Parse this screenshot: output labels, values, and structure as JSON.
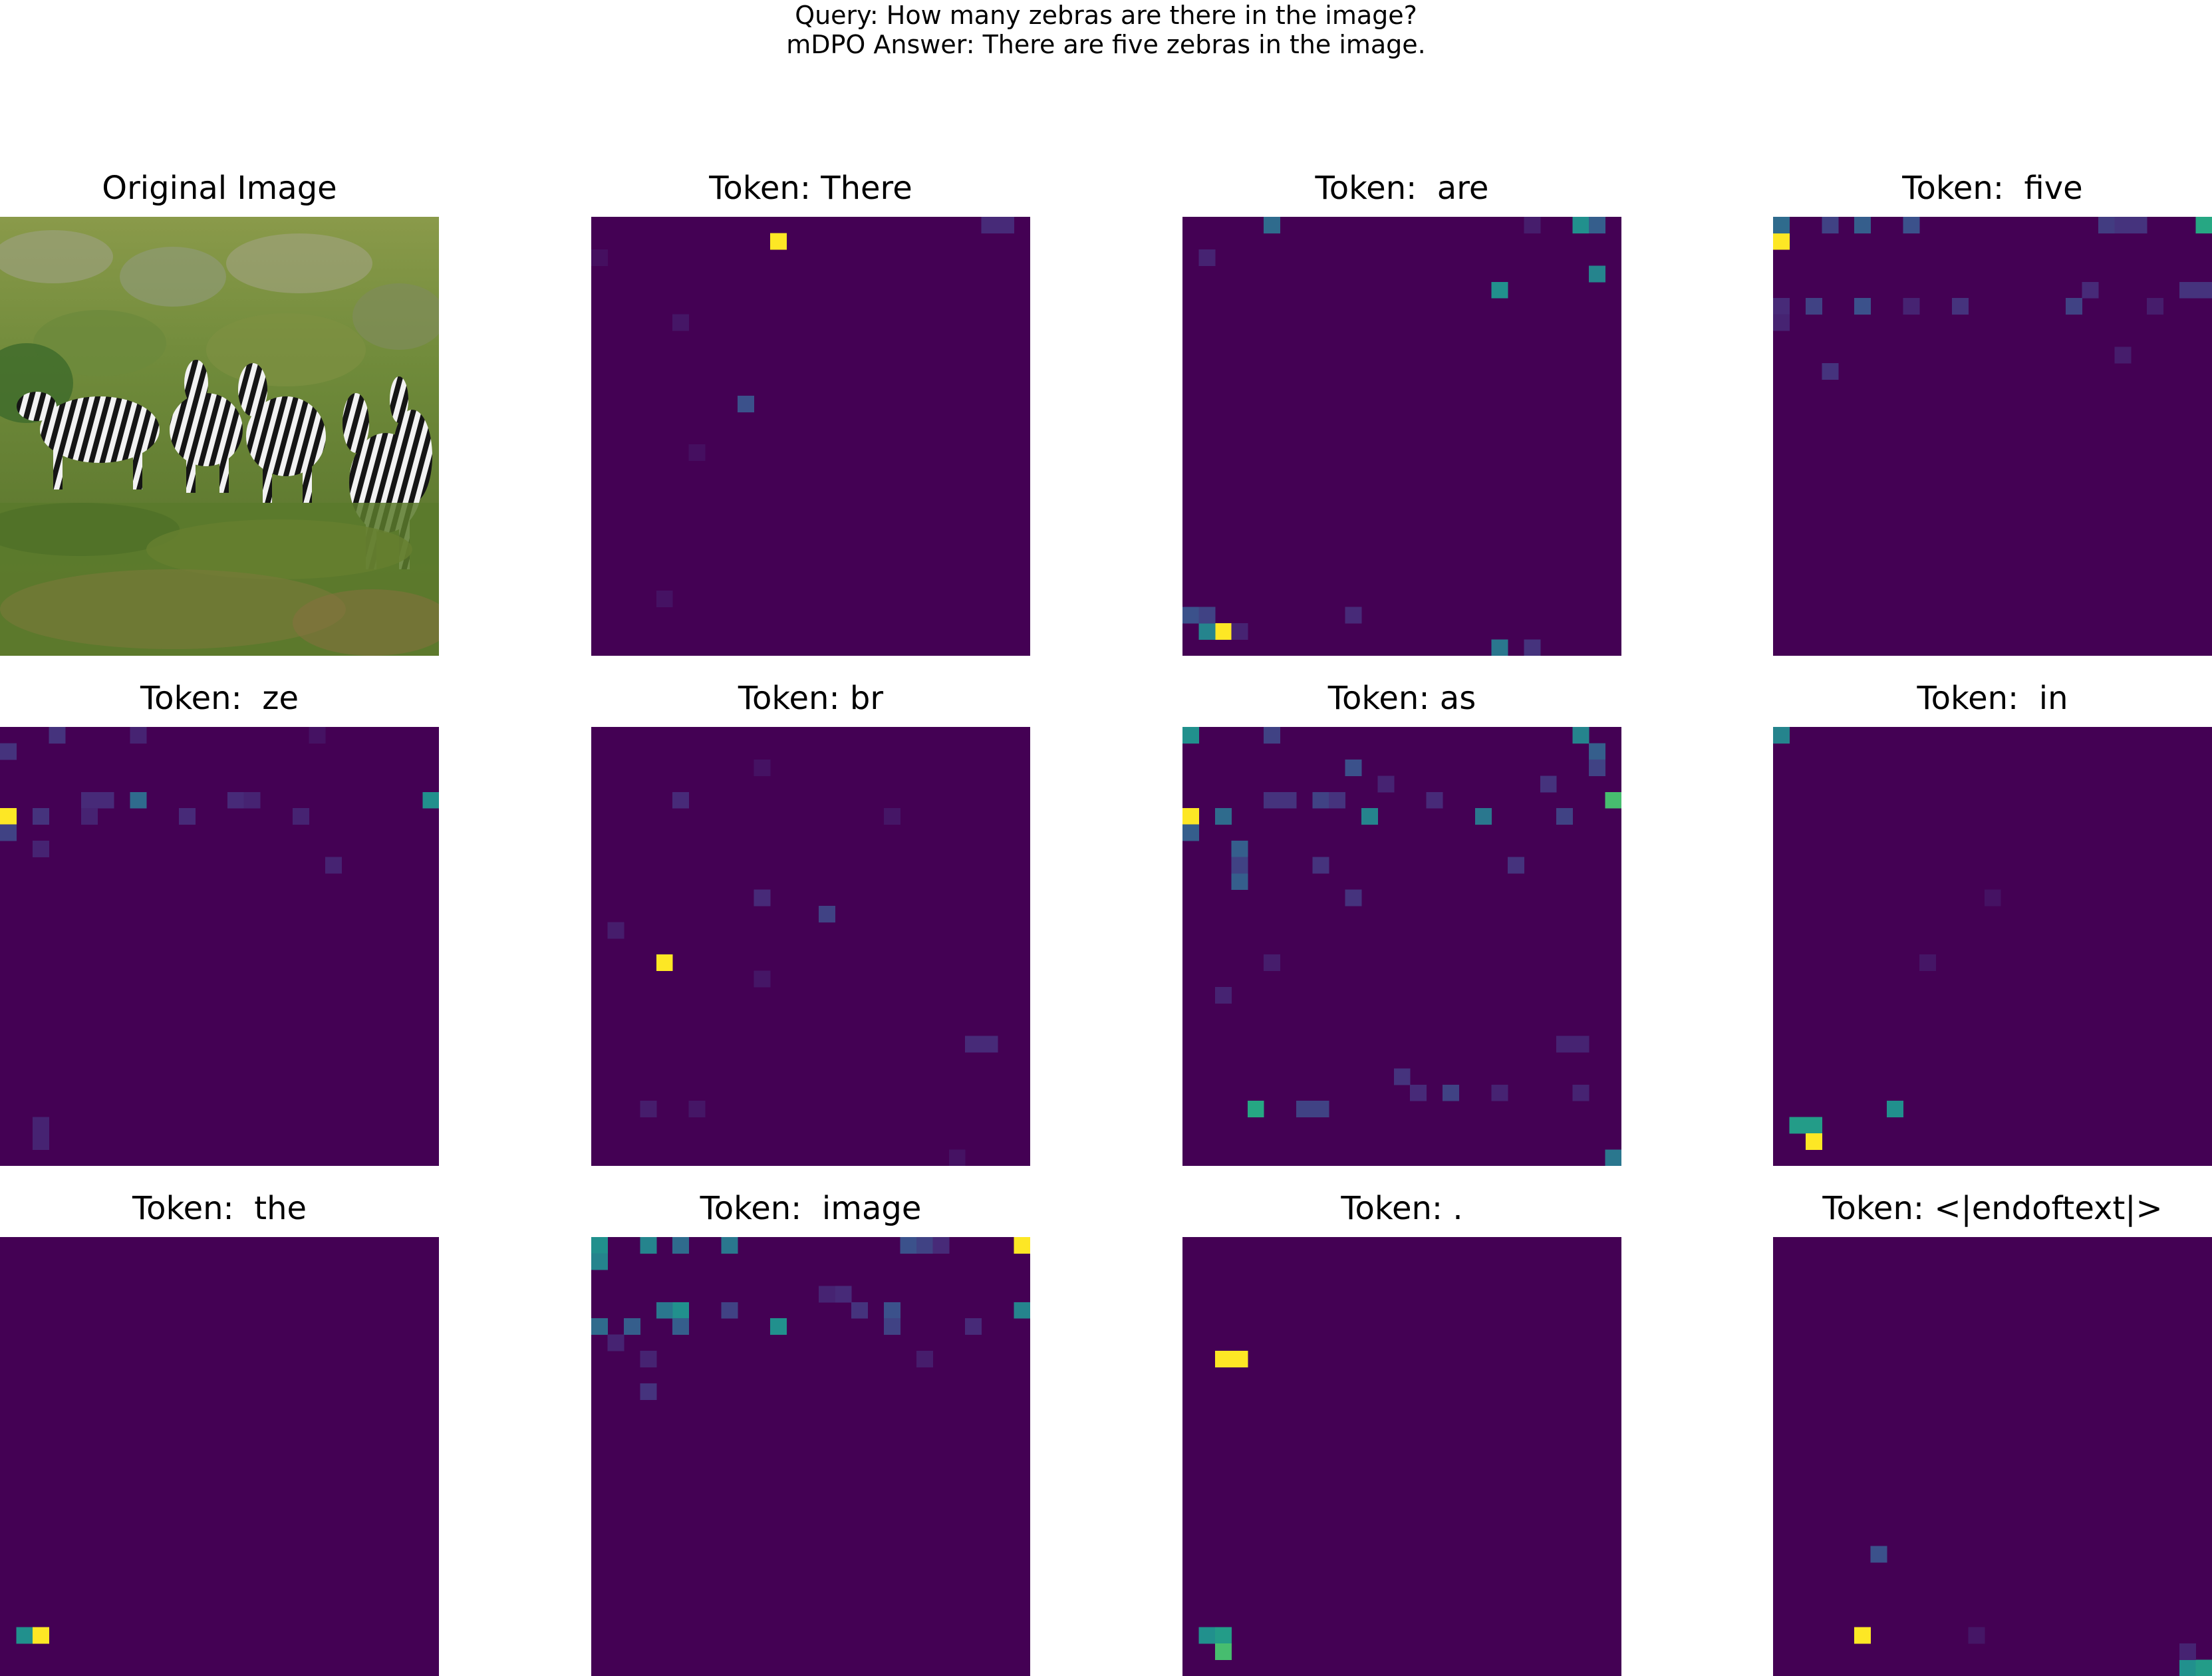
{
  "figure": {
    "query": "Query: How many zebras are there in the image?",
    "answer": "mDPO Answer: There are five zebras in the image."
  },
  "original_image": {
    "title": "Original Image",
    "description": "photo: five zebras walking through tall green grass and shrubs"
  },
  "colors": {
    "background": "#440154",
    "colormap": "viridis"
  },
  "chart_data": {
    "type": "heatmap",
    "grid_size": 27,
    "value_range": [
      0,
      1
    ],
    "colormap": "viridis",
    "panels": [
      {
        "title": "Token: There",
        "cells": [
          [
            1,
            11,
            1.0
          ],
          [
            11,
            9,
            0.25
          ],
          [
            0,
            24,
            0.12
          ],
          [
            0,
            25,
            0.12
          ],
          [
            6,
            5,
            0.06
          ],
          [
            23,
            4,
            0.05
          ],
          [
            14,
            6,
            0.04
          ],
          [
            2,
            0,
            0.04
          ]
        ]
      },
      {
        "title": "Token:  are",
        "cells": [
          [
            25,
            2,
            1.0
          ],
          [
            25,
            1,
            0.45
          ],
          [
            24,
            0,
            0.25
          ],
          [
            24,
            1,
            0.2
          ],
          [
            4,
            19,
            0.5
          ],
          [
            3,
            25,
            0.45
          ],
          [
            0,
            5,
            0.35
          ],
          [
            0,
            24,
            0.5
          ],
          [
            0,
            25,
            0.3
          ],
          [
            26,
            19,
            0.4
          ],
          [
            26,
            21,
            0.15
          ],
          [
            24,
            10,
            0.12
          ],
          [
            25,
            3,
            0.1
          ],
          [
            2,
            1,
            0.1
          ],
          [
            0,
            21,
            0.08
          ]
        ]
      },
      {
        "title": "Token:  five",
        "cells": [
          [
            1,
            0,
            1.0
          ],
          [
            0,
            0,
            0.35
          ],
          [
            0,
            26,
            0.6
          ],
          [
            0,
            3,
            0.2
          ],
          [
            0,
            5,
            0.3
          ],
          [
            0,
            8,
            0.25
          ],
          [
            0,
            20,
            0.18
          ],
          [
            0,
            21,
            0.15
          ],
          [
            0,
            22,
            0.15
          ],
          [
            5,
            5,
            0.25
          ],
          [
            5,
            0,
            0.12
          ],
          [
            5,
            2,
            0.2
          ],
          [
            5,
            11,
            0.15
          ],
          [
            5,
            18,
            0.2
          ],
          [
            4,
            19,
            0.12
          ],
          [
            4,
            25,
            0.15
          ],
          [
            4,
            26,
            0.15
          ],
          [
            6,
            0,
            0.1
          ],
          [
            9,
            3,
            0.15
          ],
          [
            8,
            21,
            0.08
          ],
          [
            5,
            8,
            0.1
          ],
          [
            5,
            23,
            0.08
          ]
        ]
      },
      {
        "title": "Token:  ze",
        "cells": [
          [
            5,
            0,
            1.0
          ],
          [
            4,
            26,
            0.5
          ],
          [
            4,
            8,
            0.35
          ],
          [
            6,
            0,
            0.2
          ],
          [
            0,
            3,
            0.15
          ],
          [
            0,
            8,
            0.1
          ],
          [
            1,
            0,
            0.15
          ],
          [
            4,
            5,
            0.12
          ],
          [
            4,
            6,
            0.12
          ],
          [
            4,
            14,
            0.12
          ],
          [
            4,
            15,
            0.1
          ],
          [
            5,
            2,
            0.15
          ],
          [
            5,
            5,
            0.1
          ],
          [
            5,
            11,
            0.12
          ],
          [
            5,
            18,
            0.1
          ],
          [
            7,
            2,
            0.1
          ],
          [
            8,
            20,
            0.1
          ],
          [
            24,
            2,
            0.1
          ],
          [
            25,
            2,
            0.1
          ],
          [
            0,
            19,
            0.05
          ]
        ]
      },
      {
        "title": "Token: br",
        "cells": [
          [
            14,
            4,
            1.0
          ],
          [
            11,
            14,
            0.2
          ],
          [
            10,
            10,
            0.12
          ],
          [
            4,
            5,
            0.12
          ],
          [
            12,
            1,
            0.08
          ],
          [
            15,
            10,
            0.06
          ],
          [
            19,
            23,
            0.12
          ],
          [
            19,
            24,
            0.12
          ],
          [
            23,
            3,
            0.08
          ],
          [
            23,
            6,
            0.06
          ],
          [
            5,
            18,
            0.06
          ],
          [
            26,
            22,
            0.05
          ],
          [
            2,
            10,
            0.05
          ]
        ]
      },
      {
        "title": "Token: as",
        "cells": [
          [
            5,
            0,
            1.0
          ],
          [
            4,
            26,
            0.7
          ],
          [
            23,
            4,
            0.6
          ],
          [
            0,
            0,
            0.5
          ],
          [
            0,
            24,
            0.45
          ],
          [
            5,
            11,
            0.45
          ],
          [
            5,
            18,
            0.4
          ],
          [
            5,
            2,
            0.35
          ],
          [
            6,
            0,
            0.3
          ],
          [
            7,
            3,
            0.3
          ],
          [
            9,
            3,
            0.3
          ],
          [
            8,
            3,
            0.2
          ],
          [
            2,
            10,
            0.25
          ],
          [
            0,
            5,
            0.2
          ],
          [
            1,
            25,
            0.3
          ],
          [
            2,
            25,
            0.2
          ],
          [
            4,
            5,
            0.15
          ],
          [
            4,
            6,
            0.15
          ],
          [
            4,
            8,
            0.2
          ],
          [
            4,
            9,
            0.15
          ],
          [
            4,
            15,
            0.12
          ],
          [
            5,
            23,
            0.2
          ],
          [
            23,
            7,
            0.2
          ],
          [
            23,
            8,
            0.2
          ],
          [
            26,
            26,
            0.4
          ],
          [
            22,
            16,
            0.2
          ],
          [
            21,
            13,
            0.15
          ],
          [
            8,
            8,
            0.15
          ],
          [
            10,
            10,
            0.15
          ],
          [
            8,
            20,
            0.15
          ],
          [
            3,
            22,
            0.15
          ],
          [
            3,
            12,
            0.1
          ],
          [
            14,
            5,
            0.08
          ],
          [
            16,
            2,
            0.1
          ],
          [
            22,
            14,
            0.12
          ],
          [
            22,
            19,
            0.1
          ],
          [
            22,
            24,
            0.1
          ],
          [
            19,
            23,
            0.1
          ],
          [
            19,
            24,
            0.1
          ]
        ]
      },
      {
        "title": "Token:  in",
        "cells": [
          [
            24,
            2,
            0.55
          ],
          [
            25,
            2,
            1.0
          ],
          [
            23,
            7,
            0.5
          ],
          [
            0,
            0,
            0.45
          ],
          [
            24,
            1,
            0.55
          ],
          [
            14,
            9,
            0.06
          ],
          [
            10,
            13,
            0.05
          ]
        ]
      },
      {
        "title": "Token:  the",
        "cells": [
          [
            24,
            1,
            0.5
          ],
          [
            24,
            2,
            1.0
          ]
        ]
      },
      {
        "title": "Token:  image",
        "cells": [
          [
            0,
            26,
            1.0
          ],
          [
            0,
            0,
            0.5
          ],
          [
            1,
            0,
            0.45
          ],
          [
            0,
            3,
            0.45
          ],
          [
            0,
            5,
            0.35
          ],
          [
            0,
            8,
            0.4
          ],
          [
            4,
            5,
            0.5
          ],
          [
            5,
            11,
            0.5
          ],
          [
            4,
            26,
            0.45
          ],
          [
            5,
            0,
            0.35
          ],
          [
            5,
            2,
            0.3
          ],
          [
            5,
            5,
            0.3
          ],
          [
            4,
            4,
            0.4
          ],
          [
            4,
            8,
            0.2
          ],
          [
            4,
            18,
            0.25
          ],
          [
            4,
            16,
            0.15
          ],
          [
            0,
            19,
            0.25
          ],
          [
            0,
            20,
            0.2
          ],
          [
            0,
            21,
            0.12
          ],
          [
            5,
            18,
            0.2
          ],
          [
            5,
            23,
            0.12
          ],
          [
            3,
            15,
            0.12
          ],
          [
            3,
            14,
            0.1
          ],
          [
            9,
            3,
            0.15
          ],
          [
            7,
            3,
            0.1
          ],
          [
            6,
            1,
            0.1
          ],
          [
            7,
            20,
            0.08
          ]
        ]
      },
      {
        "title": "Token: .",
        "cells": [
          [
            7,
            2,
            1.0
          ],
          [
            7,
            3,
            1.0
          ],
          [
            24,
            1,
            0.5
          ],
          [
            24,
            2,
            0.55
          ],
          [
            25,
            2,
            0.7
          ]
        ]
      },
      {
        "title": "Token: <|endoftext|>",
        "cells": [
          [
            19,
            6,
            0.25
          ],
          [
            24,
            5,
            1.0
          ],
          [
            26,
            25,
            0.5
          ],
          [
            26,
            26,
            0.55
          ],
          [
            25,
            25,
            0.1
          ],
          [
            24,
            12,
            0.06
          ]
        ]
      }
    ]
  }
}
